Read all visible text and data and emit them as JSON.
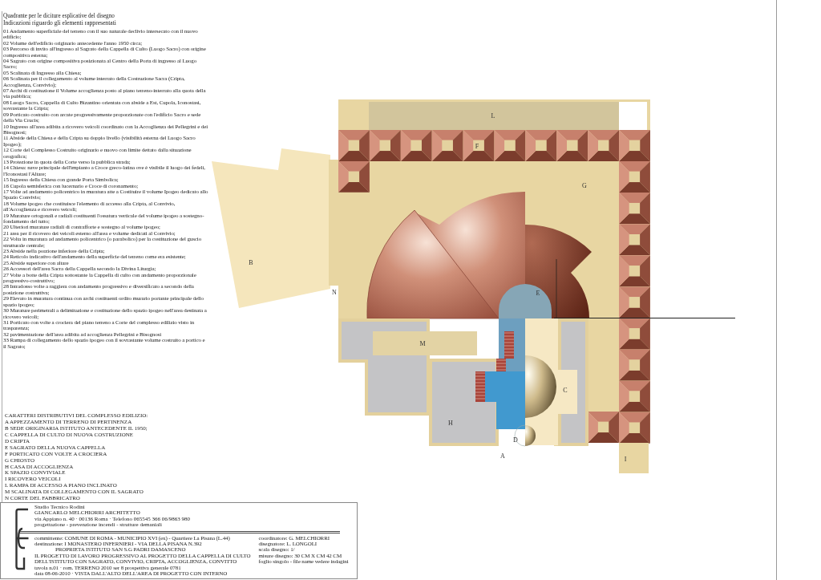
{
  "legend": {
    "title": "Quadrante per le diciture esplicative del disegno",
    "subtitle": "Indicazioni riguardo gli elementi rappresentati",
    "items": [
      "01 Andamento superficiale del terreno con il suo naturale declivio intersecato con il nuovo edificio;",
      "02 Volume dell'edificio originario antecedente l'anno 1950 circa;",
      "03 Percorso di invito all'ingresso al Sagrato della Cappella di Culto (Luogo Sacro) con origine compositiva esterna;",
      "04 Sagrato con origine compositiva posizionata al Centro della Porta di ingresso al Luogo Sacro;",
      "05 Scalinata di Ingresso alla Chiesa;",
      "06 Scalinata per il collegamento al volume interrato della Costruzione Sacra (Cripta, Accoglienza, Convivio);",
      "07 Archi di costituzione il Volume accoglienza posto al piano terreno-interrato alla quota della via pubblica;",
      "08 Luogo Sacro, Cappella di Culto Bizantino orientata con abside a Est, Cupola, Iconostasi, sovrastante la Cripta;",
      "09 Porticato costruito con arcate progressivamente proporzionate con l'edificio Sacro e sede della Via Crucis;",
      "10 Ingresso all'area adibita a ricovero veicoli coordinato con la Accoglienza dei Pellegrini e dei Bisognosi;",
      "11 Abside della Chiesa e della Cripta su doppio livello (visibilità esterna del Luogo Sacro Ipogeo);",
      "12 Corte del Complesso Costruito originario e nuovo con limite dettato dalla situazione orografica;",
      "13 Protezione in quota della Corte verso la pubblica strada;",
      "14 Chiesa: nave principale dell'impianto a Croce greco-latina ove è visibile il luogo dei fedeli, l'Iconostasi l'Altare;",
      "15 Ingresso della Chiesa con grande Porta Simbolica;",
      "16 Cupola semisferica con lucernario e Croce di coronamento;",
      "17 Volte ad andamento policentrico in muratura atte a Costituire il volume Ipogeo dedicato allo Spazio Convivio;",
      "18 Volume ipogeo che costituisce l'elemento di accesso alla Cripta, al Convivio, all'Accoglienza e ricovero veicoli;",
      "19 Murature ortogonali e radiali costituenti l'ossatura verticale del volume ipogeo a sostegno-fondamento del tutto;",
      "20 Ulteriori murature radiali di contrafforte e sostegno al volume ipogeo;",
      "21 area per il ricovero dei veicoli esterno all'area e volume dedicati al Convivio;",
      "22 Volta in muratura ad andamento policentrico (o parabolico) per la costituzione del guscio strutturale centrale;",
      "23 Abside nella porzione inferiore della Cripta;",
      "24 Reticolo indicativo dell'andamento della superficie del terreno come era esistente;",
      "25 Abside superiore con altare",
      "26 Accessori dell'area Sacra della Cappella secondo la Divina Liturgia;",
      "27 Volte a botte della Cripta sottostante la Cappella di culto con andamento proporzionale progressivo-costruttivo;",
      "28 Intradosso volte a raggiera con andamento progressivo e diversificato a secondo della posizione costruttiva;",
      "29 Elevato in muratura continua con archi costituenti ordito murario portante principale dello spazio ipogeo;",
      "30 Murature perimetrali a delimitazione e costituzione dello spazio ipogeo nell'area destinata a ricovero veicoli;",
      "31 Porticato con volte a crociera del piano terreno a Corte del complesso edilizio visto in trasparenza;",
      "32 pavimentazione dell'area adibita ad accoglienza Pellegrini e Bisognosi",
      "33 Rampa di collegamento dello spazio ipogeo con il sovrastante volume costruito a portico e il Sagrato;"
    ]
  },
  "site_plan": {
    "labels": [
      "L",
      "F",
      "G",
      "B",
      "N",
      "E",
      "M",
      "C",
      "H",
      "D",
      "A",
      "I"
    ]
  },
  "areas": {
    "heading": "CARATTERI DISTRIBUTIVI DEL COMPLESSO EDILIZIO:",
    "items": [
      "A APPEZZAMENTO DI TERRENO DI PERTINENZA",
      "B SEDE ORIGINARIA ISTITUTO ANTECEDENTE IL 1950;",
      "C CAPPELLA DI CULTO DI NUOVA COSTRUZIONE",
      "D CRIPTA",
      "E SAGRATO DELLA NUOVA CAPPELLA",
      "F PORTICATO CON VOLTE A CROCIERA",
      "G CHIOSTO",
      "H CASA DI ACCOGLIENZA",
      "K SPAZIO CONVIVIALE",
      "I RICOVERO VEICOLI",
      "L RAMPA DI ACCESSO A PIANO INCLINATO",
      "M SCALINATA DI COLLEGAMENTO CON IL SAGRATO",
      "N CORTE DEL FABBRICATRO"
    ]
  },
  "title_block": {
    "studio": [
      "Studio Tecnico Rodini",
      "GIANCARLO MELCHIORRI ARCHITETTO",
      "via Appiano n. 40 · 00136 Roma · Telefono 065545 366 06/9863 980",
      "progettazione - prevenzione incendi - strutture demaniali"
    ],
    "project": [
      {
        "kind": "line",
        "text": "committente: COMUNE DI ROMA - MUNICIPIO XVI (ex) - Quartiere La Pisana (L.44)"
      },
      {
        "kind": "line",
        "text": "destinazione: I MONASTERO INFERNIERI - VIA DELLA PISANA N.392"
      },
      {
        "kind": "subheading",
        "text": "PROPRIETA ISTITUTO SAN S.G PADRI DAMASCENO"
      },
      {
        "kind": "line",
        "text": "IL PROGETTO DI LAVORO PROGRESSIVO AL PROGETTO DELLA CAPPELLA DI CULTO"
      },
      {
        "kind": "line",
        "text": "DELL'ISTITUTO CON SAGRATO, CONVIVIO, CRIPTA, ACCOGLIENZA, CONVITTO"
      },
      {
        "kind": "line",
        "text": "tavola n.01 · rom. TERRENO 2010 ser 8 prospettiva generale 0781"
      },
      {
        "kind": "line",
        "text": "data 08-06-2010 · VISTA DALL'ALTO DELL'AREA DI PROGETTO CON INTERNO"
      }
    ],
    "details": [
      "coordinatore: G. MELCHIORRI",
      "disegnatore: L. LONGOLI",
      "scala disegno: 1/",
      "misure disegno: 30 CM X CM 42 CM",
      "foglio singolo - file name vedere indagini"
    ]
  }
}
